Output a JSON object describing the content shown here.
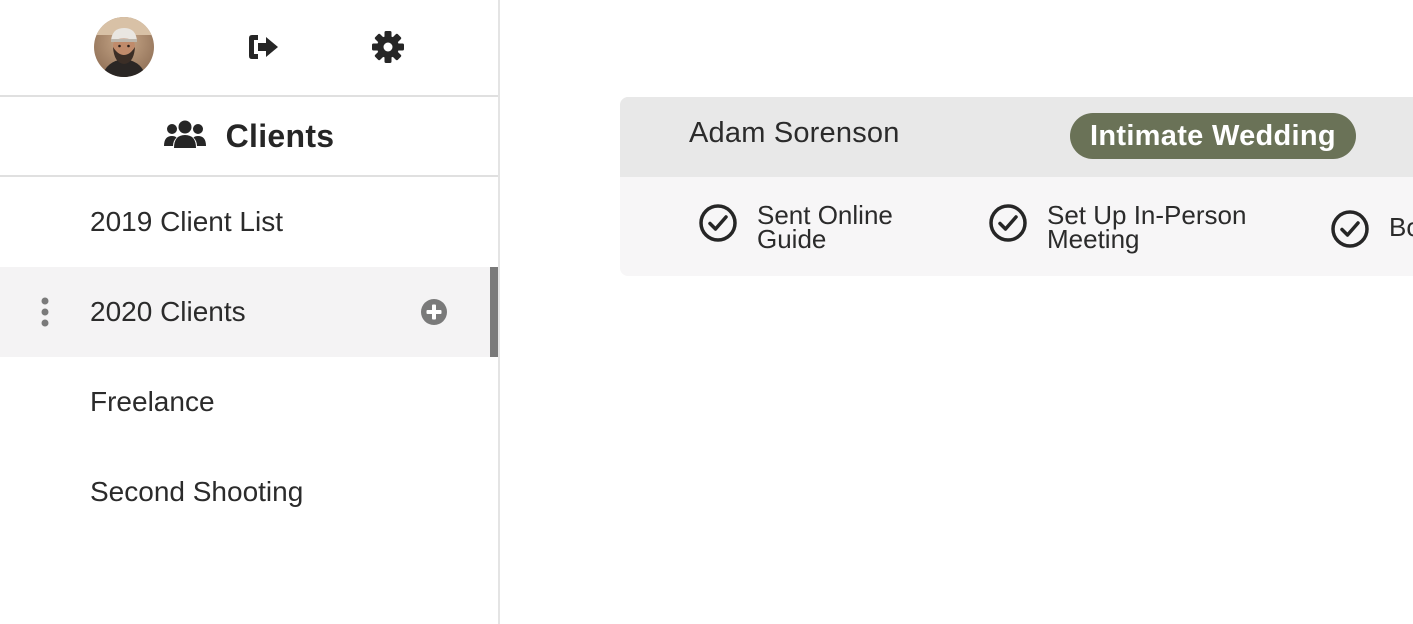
{
  "user": {
    "avatar_icon": "user-avatar"
  },
  "toolbar": {
    "logout_icon": "sign-out-icon",
    "settings_icon": "gear-icon"
  },
  "sidebar": {
    "section_title": "Clients",
    "section_icon": "users-icon",
    "items": [
      {
        "label": "2019 Client List",
        "active": false
      },
      {
        "label": "2020 Clients",
        "active": true
      },
      {
        "label": "Freelance",
        "active": false
      },
      {
        "label": "Second Shooting",
        "active": false
      }
    ]
  },
  "client_card": {
    "name": "Adam Sorenson",
    "package": "Intimate Wedding",
    "package_color": "#6a7257",
    "tasks": [
      {
        "line1": "Sent Online",
        "line2": "Guide",
        "done": true
      },
      {
        "line1": "Set Up In-Person",
        "line2": "Meeting",
        "done": true
      },
      {
        "line1": "Bo",
        "line2": "",
        "done": true
      }
    ]
  }
}
